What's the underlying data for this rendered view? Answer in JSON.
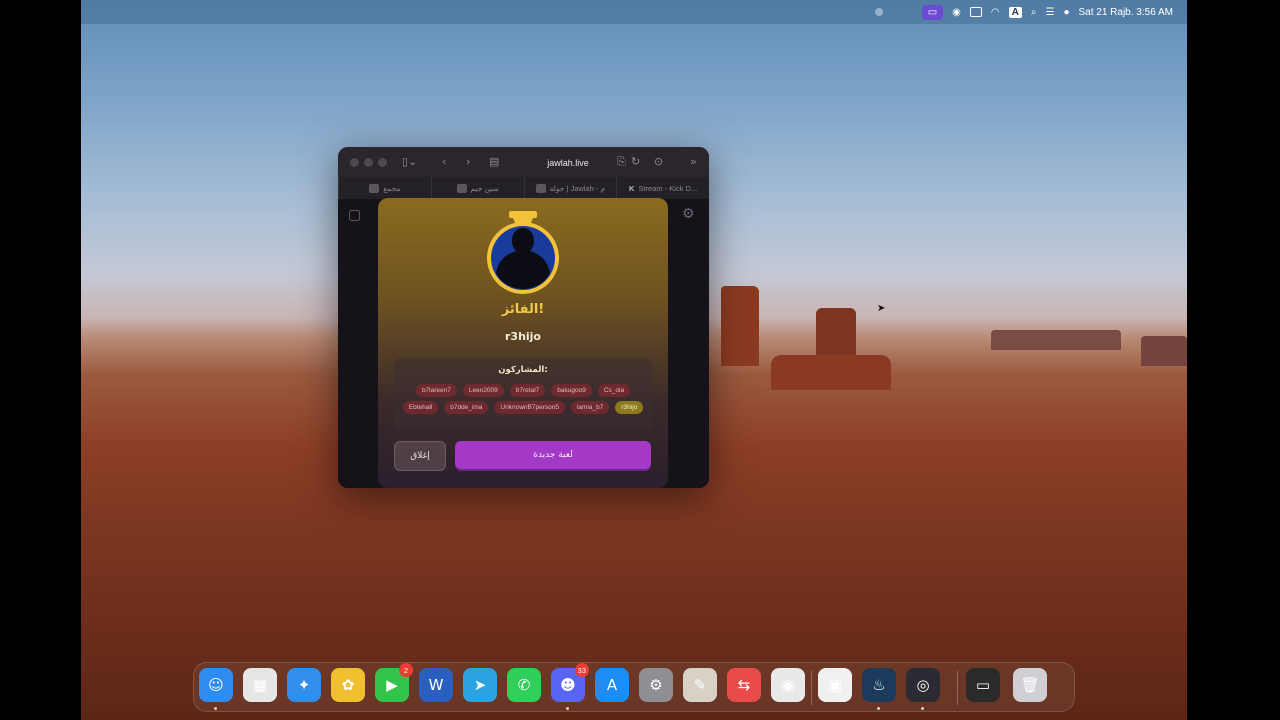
{
  "menubar": {
    "datetime": "Sat 21 Rajb. 3:56 AM",
    "input_source": "A"
  },
  "browser": {
    "url": "jawlah.live",
    "tabs": [
      {
        "label": "مجمع"
      },
      {
        "label": "سين جيم"
      },
      {
        "label": "جولة | Jawlah - م"
      },
      {
        "label": "Stream - Kick D..."
      }
    ]
  },
  "modal": {
    "title": "الفائز!",
    "winner_name": "r3hijo",
    "participants_title": "المشاركون:",
    "participants": [
      "Cs_ola",
      "bakugoo9",
      "b7retal7",
      "Leen2009",
      "b7lareen7",
      "r3hijo",
      "lamia_b7",
      "UnknownB7person5",
      "b7dde_ima",
      "Ebtehall"
    ],
    "winner_chip_index": 5,
    "close_label": "إغلاق",
    "new_game_label": "لعبة جديدة"
  },
  "dock": {
    "items": [
      {
        "name": "finder",
        "glyph": "☺",
        "color": "#2e8bf0"
      },
      {
        "name": "launchpad",
        "glyph": "▦",
        "color": "#e6e6e6"
      },
      {
        "name": "safari",
        "glyph": "✦",
        "color": "#2f8fea"
      },
      {
        "name": "photos",
        "glyph": "✿",
        "color": "#f0c030"
      },
      {
        "name": "facetime",
        "glyph": "▶",
        "color": "#33c24a",
        "badge": "2"
      },
      {
        "name": "word",
        "glyph": "W",
        "color": "#2a5fbf"
      },
      {
        "name": "telegram",
        "glyph": "➤",
        "color": "#2aa3e0"
      },
      {
        "name": "whatsapp",
        "glyph": "✆",
        "color": "#2fcf5a"
      },
      {
        "name": "discord",
        "glyph": "☻",
        "color": "#5865f2",
        "badge": "33"
      },
      {
        "name": "app-store",
        "glyph": "A",
        "color": "#1c8df5"
      },
      {
        "name": "system-settings",
        "glyph": "⚙",
        "color": "#8e8e93"
      },
      {
        "name": "notes",
        "glyph": "✎",
        "color": "#d8d2c6"
      },
      {
        "name": "remote-desktop",
        "glyph": "⇆",
        "color": "#e94a4a"
      },
      {
        "name": "chrome",
        "glyph": "◉",
        "color": "#e9e9e9"
      },
      {
        "name": "elgato",
        "glyph": "▣",
        "color": "#f0f0f0"
      },
      {
        "name": "steam",
        "glyph": "♨",
        "color": "#1b3a5c"
      },
      {
        "name": "obs",
        "glyph": "◎",
        "color": "#2b2b33"
      },
      {
        "name": "screen-preview",
        "glyph": "▭",
        "color": "#2a2a2a"
      },
      {
        "name": "trash",
        "glyph": "🗑",
        "color": "#d0d0d4"
      }
    ]
  }
}
